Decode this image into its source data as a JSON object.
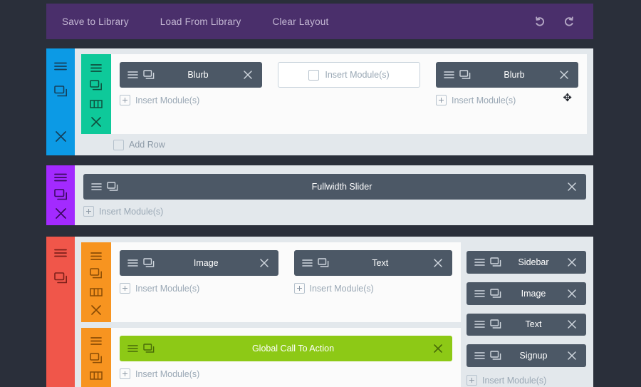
{
  "toolbar": {
    "buttons": [
      {
        "label": "Save to Library",
        "name": "save-to-library-button"
      },
      {
        "label": "Load From Library",
        "name": "load-from-library-button"
      },
      {
        "label": "Clear Layout",
        "name": "clear-layout-button"
      }
    ],
    "undo_icon": "undo-icon",
    "redo_icon": "redo-icon",
    "background": "#4a2f6b",
    "text_color": "#c4b8d4"
  },
  "labels": {
    "insert_modules": "Insert Module(s)",
    "add_row": "Add Row"
  },
  "colors": {
    "page_background": "#2a2f3a",
    "section_background": "#e3e8ec",
    "row_background": "#fbfbfb",
    "module": "#4c5866",
    "module_global": "#8dc916",
    "section1_rail": "#0c9ae5",
    "section1_column_rail": "#0ec99a",
    "section2_rail": "#a32aff",
    "section3_rail": "#f0564a",
    "section3_column_rail": "#f79420"
  },
  "sections": [
    {
      "name": "section-blue",
      "rail_color": "#0c9ae5",
      "rail_icons": [
        "hamburger-icon",
        "clone-icon"
      ],
      "rail_bottom_icon": "close-icon",
      "rows": [
        {
          "name": "row-1",
          "rail_color": "#0ec99a",
          "rail_icons": [
            "hamburger-icon",
            "clone-icon",
            "columns-icon",
            "close-icon"
          ],
          "columns": [
            {
              "modules": [
                {
                  "title": "Blurb",
                  "style": "dark"
                }
              ],
              "insert": true
            },
            {
              "modules": [],
              "insert_box": true
            },
            {
              "modules": [
                {
                  "title": "Blurb",
                  "style": "dark"
                }
              ],
              "insert": true
            }
          ]
        }
      ],
      "footer": "Add Row",
      "move_cursor": true
    },
    {
      "name": "section-purple",
      "rail_color": "#a32aff",
      "rail_icons": [
        "hamburger-icon",
        "clone-icon",
        "close-icon"
      ],
      "rows": [
        {
          "name": "row-fullwidth",
          "rail_color": null,
          "rail_icons": [],
          "columns": [
            {
              "modules": [
                {
                  "title": "Fullwidth Slider",
                  "style": "dark"
                }
              ],
              "insert": true
            }
          ]
        }
      ]
    },
    {
      "name": "section-red",
      "rail_color": "#f0564a",
      "rail_icons": [
        "hamburger-icon",
        "clone-icon"
      ],
      "rows": [
        {
          "name": "row-2",
          "rail_color": "#f79420",
          "rail_icons": [
            "hamburger-icon",
            "clone-icon",
            "columns-icon",
            "close-icon"
          ],
          "columns": [
            {
              "modules": [
                {
                  "title": "Image",
                  "style": "dark"
                }
              ],
              "insert": true
            },
            {
              "modules": [
                {
                  "title": "Text",
                  "style": "dark"
                }
              ],
              "insert": true
            }
          ]
        },
        {
          "name": "row-3",
          "rail_color": "#f79420",
          "rail_icons": [
            "hamburger-icon",
            "clone-icon",
            "columns-icon"
          ],
          "columns": [
            {
              "modules": [
                {
                  "title": "Global Call To Action",
                  "style": "green"
                }
              ],
              "insert": true
            }
          ]
        }
      ],
      "sidebar_column": {
        "name": "sidebar-module-stack",
        "modules": [
          {
            "title": "Sidebar",
            "style": "dark"
          },
          {
            "title": "Image",
            "style": "dark"
          },
          {
            "title": "Text",
            "style": "dark"
          },
          {
            "title": "Signup",
            "style": "dark"
          }
        ],
        "insert": true
      }
    }
  ]
}
